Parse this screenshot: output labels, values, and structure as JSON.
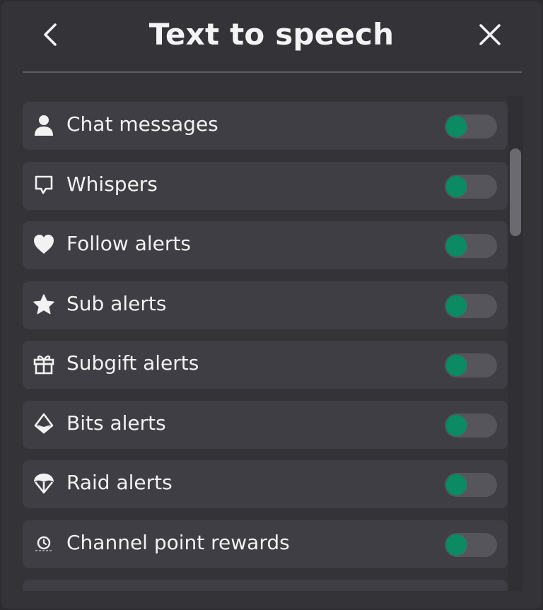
{
  "header": {
    "title": "Text to speech",
    "back_icon": "chevron-left-icon",
    "close_icon": "close-icon"
  },
  "colors": {
    "panel_background": "#333338",
    "row_background": "#3e3e44",
    "toggle_track": "#55555b",
    "toggle_knob": "#0b8a63",
    "text": "#f2f2f2"
  },
  "items": [
    {
      "label": "Chat messages",
      "icon": "user-icon",
      "enabled": true
    },
    {
      "label": "Whispers",
      "icon": "speech-bubble-icon",
      "enabled": true
    },
    {
      "label": "Follow alerts",
      "icon": "heart-icon",
      "enabled": true
    },
    {
      "label": "Sub alerts",
      "icon": "star-icon",
      "enabled": true
    },
    {
      "label": "Subgift alerts",
      "icon": "gift-icon",
      "enabled": true
    },
    {
      "label": "Bits alerts",
      "icon": "bits-gem-icon",
      "enabled": true
    },
    {
      "label": "Raid alerts",
      "icon": "parachute-icon",
      "enabled": true
    },
    {
      "label": "Channel point rewards",
      "icon": "channel-points-icon",
      "enabled": true
    },
    {
      "label": "",
      "icon": "",
      "enabled": true
    }
  ]
}
